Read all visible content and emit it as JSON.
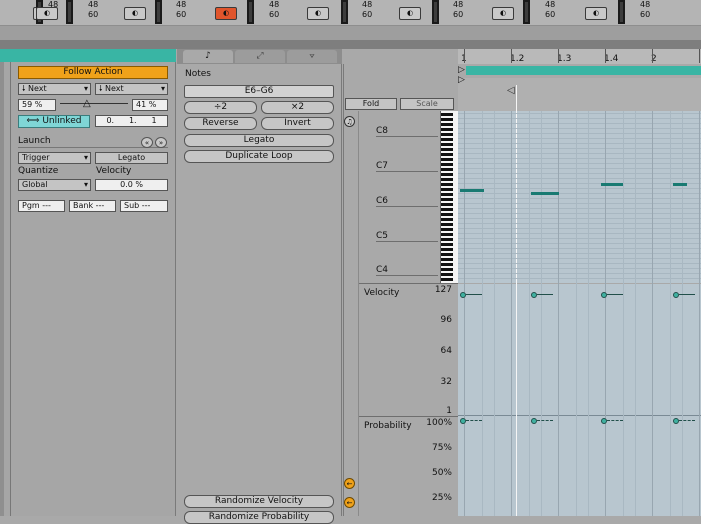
{
  "mixer": {
    "channels": [
      {
        "button_glyph": "◐",
        "top": "48",
        "bottom": "60"
      },
      {
        "button_glyph": "◐",
        "top": "48",
        "bottom": "60"
      },
      {
        "button_glyph": "◐",
        "top": "48",
        "bottom": "60"
      },
      {
        "button_glyph": "◐",
        "top": "48",
        "bottom": "60"
      },
      {
        "button_glyph": "◐",
        "top": "48",
        "bottom": "60"
      },
      {
        "button_glyph": "◐",
        "top": "48",
        "bottom": "60"
      },
      {
        "button_glyph": "◐",
        "top": "48",
        "bottom": "60"
      },
      {
        "button_glyph": "◐",
        "top": "48",
        "bottom": "60"
      }
    ],
    "active_color": "#e0552c"
  },
  "clip": {
    "follow_action_label": "Follow Action",
    "action_a": "Next",
    "action_b": "Next",
    "chance_a": "59 %",
    "chance_b": "41 %",
    "unlinked_label": "Unlinked",
    "time": [
      "0.",
      "1.",
      "1"
    ],
    "launch_label": "Launch",
    "launch_mode": "Trigger",
    "legato_label": "Legato",
    "quantize_label": "Quantize",
    "velocity_label": "Velocity",
    "quantize_value": "Global",
    "velocity_value": "0.0 %",
    "pgm": "Pgm ---",
    "bank": "Bank ---",
    "sub": "Sub ---"
  },
  "notes_panel": {
    "tabs": [
      "♪",
      "⤢",
      "⟇"
    ],
    "title": "Notes",
    "range": "E6–G6",
    "plus2": "÷2",
    "times2": "×2",
    "reverse": "Reverse",
    "invert": "Invert",
    "legato": "Legato",
    "duplicate": "Duplicate Loop",
    "randomize_velocity": "Randomize Velocity",
    "randomize_probability": "Randomize Probability"
  },
  "editor": {
    "fold": "Fold",
    "scale": "Scale",
    "ruler": [
      "1",
      "1.2",
      "1.3",
      "1.4",
      "2"
    ],
    "octaves": [
      "C8",
      "C7",
      "C6",
      "C5",
      "C4"
    ],
    "velocity_label": "Velocity",
    "velocity_ticks": [
      "127",
      "96",
      "64",
      "32",
      "1"
    ],
    "probability_label": "Probability",
    "probability_ticks": [
      "100%",
      "75%",
      "50%",
      "25%"
    ],
    "teal": "#39b5a4"
  }
}
